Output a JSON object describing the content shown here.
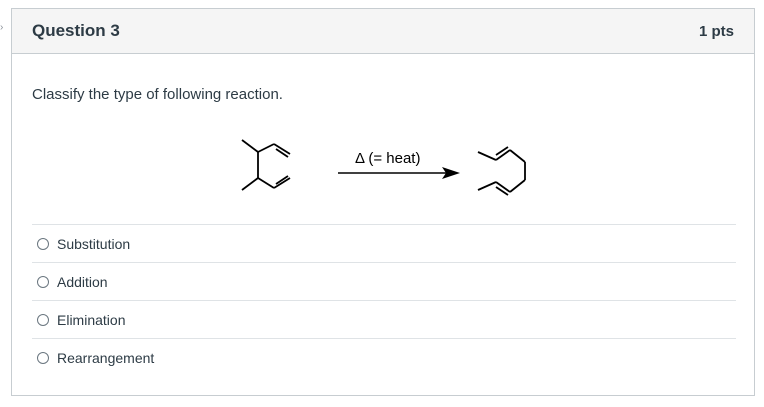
{
  "question": {
    "title": "Question 3",
    "points": "1 pts",
    "prompt": "Classify the type of following reaction.",
    "reaction_condition": "Δ  (= heat)"
  },
  "answers": [
    {
      "label": "Substitution"
    },
    {
      "label": "Addition"
    },
    {
      "label": "Elimination"
    },
    {
      "label": "Rearrangement"
    }
  ]
}
